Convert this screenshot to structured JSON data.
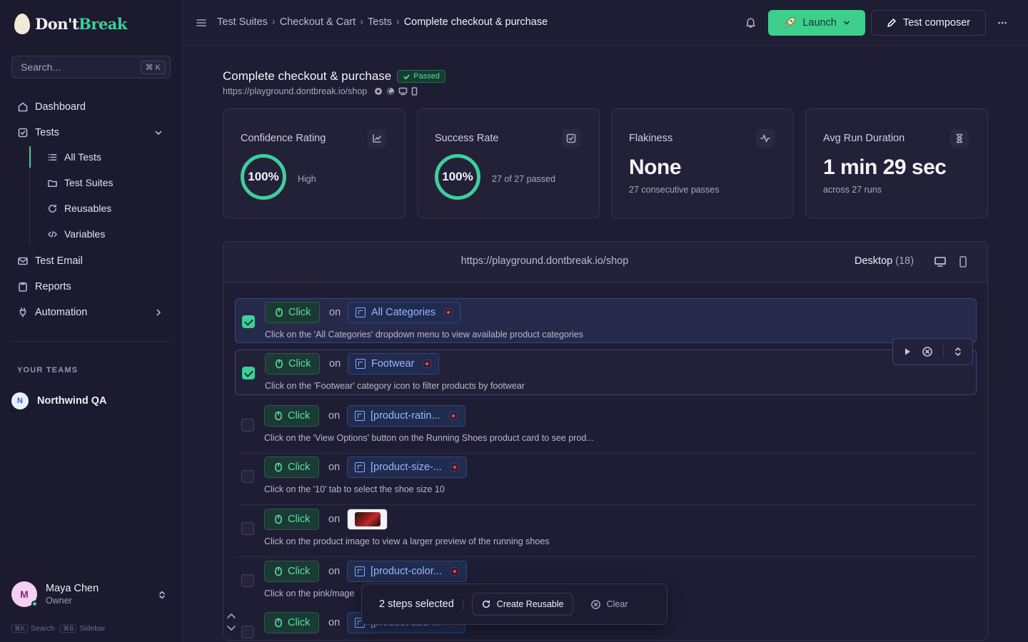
{
  "app": {
    "logo_part1": "Don't",
    "logo_part2": "Break"
  },
  "sidebar": {
    "search_placeholder": "Search...",
    "search_shortcut": "⌘ K",
    "nav": [
      {
        "label": "Dashboard",
        "icon": "home-icon"
      },
      {
        "label": "Tests",
        "icon": "checkbox-icon"
      },
      {
        "label": "Test Email",
        "icon": "mail-icon"
      },
      {
        "label": "Reports",
        "icon": "clipboard-icon"
      },
      {
        "label": "Automation",
        "icon": "plug-icon"
      }
    ],
    "tests_sub": [
      {
        "label": "All Tests",
        "icon": "list-icon"
      },
      {
        "label": "Test Suites",
        "icon": "folder-icon"
      },
      {
        "label": "Reusables",
        "icon": "refresh-icon"
      },
      {
        "label": "Variables",
        "icon": "code-icon"
      }
    ],
    "teams_label": "YOUR TEAMS",
    "team": {
      "initial": "N",
      "name": "Northwind QA"
    },
    "user": {
      "initial": "M",
      "name": "Maya Chen",
      "role": "Owner"
    },
    "hints": [
      {
        "key": "⌘K",
        "label": "Search"
      },
      {
        "key": "⌘B",
        "label": "Sidebar"
      }
    ]
  },
  "topbar": {
    "breadcrumb": [
      "Test Suites",
      "Checkout & Cart",
      "Tests",
      "Complete checkout & purchase"
    ],
    "launch_label": "Launch",
    "composer_label": "Test composer"
  },
  "test": {
    "title": "Complete checkout & purchase",
    "status": "Passed",
    "url": "https://playground.dontbreak.io/shop"
  },
  "metrics": {
    "confidence": {
      "label": "Confidence Rating",
      "value": "100%",
      "note": "High"
    },
    "success": {
      "label": "Success Rate",
      "value": "100%",
      "note": "27 of 27 passed"
    },
    "flakiness": {
      "label": "Flakiness",
      "value": "None",
      "note": "27 consecutive passes"
    },
    "duration": {
      "label": "Avg Run Duration",
      "value": "1 min 29 sec",
      "note": "across 27 runs"
    }
  },
  "steps_panel": {
    "url": "https://playground.dontbreak.io/shop",
    "viewport_label": "Desktop",
    "viewport_count": "(18)",
    "on_word": "on",
    "steps": [
      {
        "action": "Click",
        "target": "All Categories",
        "desc": "Click on the 'All Categories' dropdown menu to view available product categories",
        "checked": true
      },
      {
        "action": "Click",
        "target": "Footwear",
        "desc": "Click on the 'Footwear' category icon to filter products by footwear",
        "checked": true
      },
      {
        "action": "Click",
        "target": "[product-ratin...",
        "desc": "Click on the 'View Options' button on the Running Shoes product card to see prod...",
        "checked": false
      },
      {
        "action": "Click",
        "target": "[product-size-...",
        "desc": "Click on the '10' tab to select the shoe size 10",
        "checked": false
      },
      {
        "action": "Click",
        "target": "",
        "desc": "Click on the product image to view a larger preview of the running shoes",
        "checked": false
      },
      {
        "action": "Click",
        "target": "[product-color...",
        "desc": "Click on the pink/mage",
        "checked": false
      },
      {
        "action": "Click",
        "target": "[product-add-...",
        "desc": "",
        "checked": false
      }
    ]
  },
  "selection_bar": {
    "count_label": "2 steps selected",
    "create_label": "Create Reusable",
    "clear_label": "Clear"
  }
}
